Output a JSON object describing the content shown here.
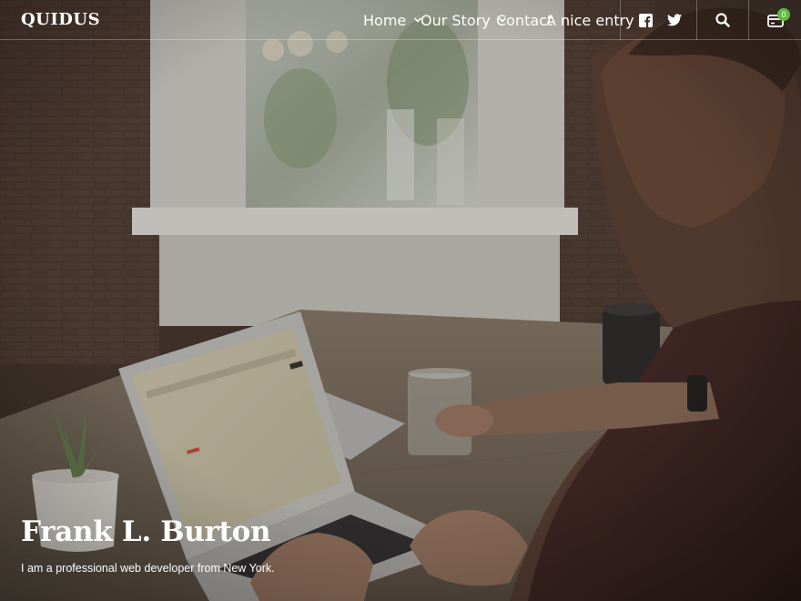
{
  "header": {
    "brand": "QUIDUS",
    "nav": [
      {
        "label": "Home",
        "has_dropdown": true
      },
      {
        "label": "Our Story",
        "has_dropdown": true
      },
      {
        "label": "Contact",
        "has_dropdown": false
      },
      {
        "label": "A nice entry",
        "has_dropdown": false
      }
    ],
    "social_icons": [
      "facebook-icon",
      "twitter-icon"
    ],
    "search_icon": "search-icon",
    "cart": {
      "icon": "cart-icon",
      "count": "0"
    }
  },
  "hero": {
    "title": "Frank L. Burton",
    "subtitle": "I am a professional web developer from New York."
  },
  "colors": {
    "text": "#ffffff",
    "badge": "#5bbd3f",
    "overlay": "#3a322c"
  }
}
